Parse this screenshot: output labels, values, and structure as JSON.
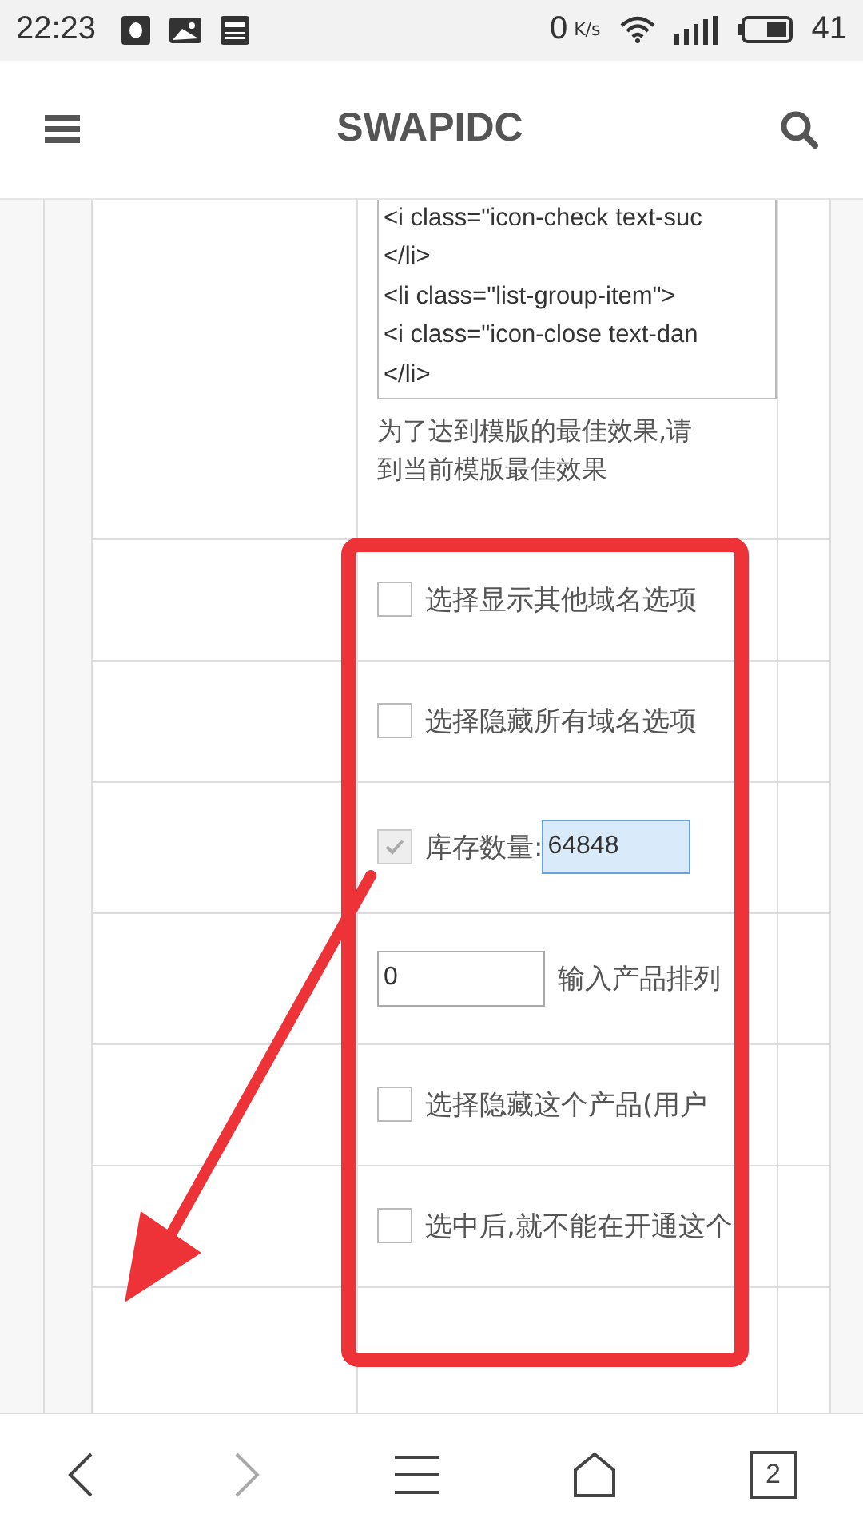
{
  "status_bar": {
    "time": "22:23",
    "speed": "0",
    "speed_unit": "K/s",
    "battery": "41"
  },
  "header": {
    "title": "SWAPIDC"
  },
  "code_box": {
    "lines": [
      "<i class=\"icon-check text-suc",
      "</li>",
      "<li class=\"list-group-item\">",
      "<i class=\"icon-close text-dan",
      "</li>"
    ]
  },
  "note": [
    "为了达到模版的最佳效果,请",
    "到当前模版最佳效果"
  ],
  "options": [
    {
      "kind": "checkbox",
      "label": "选择显示其他域名选项",
      "checked": false,
      "disabled": false
    },
    {
      "kind": "checkbox",
      "label": "选择隐藏所有域名选项",
      "checked": false,
      "disabled": false
    },
    {
      "kind": "checkbox-input",
      "label": "库存数量:",
      "checked": true,
      "disabled": true,
      "value": "64848"
    },
    {
      "kind": "input-label",
      "value": "0",
      "label": "输入产品排列"
    },
    {
      "kind": "checkbox",
      "label": "选择隐藏这个产品(用户",
      "checked": false,
      "disabled": false
    },
    {
      "kind": "checkbox",
      "label": "选中后,就不能在开通这个",
      "checked": false,
      "disabled": false
    }
  ],
  "nav": [
    {
      "kind": "back",
      "disabled": false
    },
    {
      "kind": "forward",
      "disabled": true
    },
    {
      "kind": "menu",
      "disabled": false
    },
    {
      "kind": "home",
      "disabled": false
    },
    {
      "kind": "tabs",
      "count": "2",
      "disabled": false
    }
  ]
}
